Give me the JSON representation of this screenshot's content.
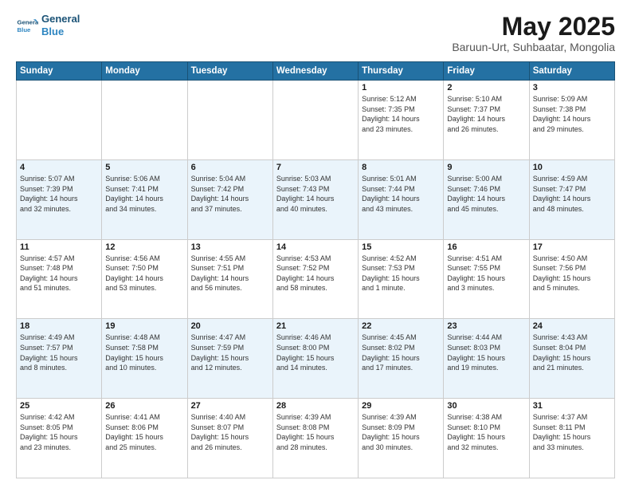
{
  "logo": {
    "line1": "General",
    "line2": "Blue"
  },
  "title": "May 2025",
  "subtitle": "Baruun-Urt, Suhbaatar, Mongolia",
  "days_of_week": [
    "Sunday",
    "Monday",
    "Tuesday",
    "Wednesday",
    "Thursday",
    "Friday",
    "Saturday"
  ],
  "weeks": [
    [
      {
        "num": "",
        "info": ""
      },
      {
        "num": "",
        "info": ""
      },
      {
        "num": "",
        "info": ""
      },
      {
        "num": "",
        "info": ""
      },
      {
        "num": "1",
        "info": "Sunrise: 5:12 AM\nSunset: 7:35 PM\nDaylight: 14 hours\nand 23 minutes."
      },
      {
        "num": "2",
        "info": "Sunrise: 5:10 AM\nSunset: 7:37 PM\nDaylight: 14 hours\nand 26 minutes."
      },
      {
        "num": "3",
        "info": "Sunrise: 5:09 AM\nSunset: 7:38 PM\nDaylight: 14 hours\nand 29 minutes."
      }
    ],
    [
      {
        "num": "4",
        "info": "Sunrise: 5:07 AM\nSunset: 7:39 PM\nDaylight: 14 hours\nand 32 minutes."
      },
      {
        "num": "5",
        "info": "Sunrise: 5:06 AM\nSunset: 7:41 PM\nDaylight: 14 hours\nand 34 minutes."
      },
      {
        "num": "6",
        "info": "Sunrise: 5:04 AM\nSunset: 7:42 PM\nDaylight: 14 hours\nand 37 minutes."
      },
      {
        "num": "7",
        "info": "Sunrise: 5:03 AM\nSunset: 7:43 PM\nDaylight: 14 hours\nand 40 minutes."
      },
      {
        "num": "8",
        "info": "Sunrise: 5:01 AM\nSunset: 7:44 PM\nDaylight: 14 hours\nand 43 minutes."
      },
      {
        "num": "9",
        "info": "Sunrise: 5:00 AM\nSunset: 7:46 PM\nDaylight: 14 hours\nand 45 minutes."
      },
      {
        "num": "10",
        "info": "Sunrise: 4:59 AM\nSunset: 7:47 PM\nDaylight: 14 hours\nand 48 minutes."
      }
    ],
    [
      {
        "num": "11",
        "info": "Sunrise: 4:57 AM\nSunset: 7:48 PM\nDaylight: 14 hours\nand 51 minutes."
      },
      {
        "num": "12",
        "info": "Sunrise: 4:56 AM\nSunset: 7:50 PM\nDaylight: 14 hours\nand 53 minutes."
      },
      {
        "num": "13",
        "info": "Sunrise: 4:55 AM\nSunset: 7:51 PM\nDaylight: 14 hours\nand 56 minutes."
      },
      {
        "num": "14",
        "info": "Sunrise: 4:53 AM\nSunset: 7:52 PM\nDaylight: 14 hours\nand 58 minutes."
      },
      {
        "num": "15",
        "info": "Sunrise: 4:52 AM\nSunset: 7:53 PM\nDaylight: 15 hours\nand 1 minute."
      },
      {
        "num": "16",
        "info": "Sunrise: 4:51 AM\nSunset: 7:55 PM\nDaylight: 15 hours\nand 3 minutes."
      },
      {
        "num": "17",
        "info": "Sunrise: 4:50 AM\nSunset: 7:56 PM\nDaylight: 15 hours\nand 5 minutes."
      }
    ],
    [
      {
        "num": "18",
        "info": "Sunrise: 4:49 AM\nSunset: 7:57 PM\nDaylight: 15 hours\nand 8 minutes."
      },
      {
        "num": "19",
        "info": "Sunrise: 4:48 AM\nSunset: 7:58 PM\nDaylight: 15 hours\nand 10 minutes."
      },
      {
        "num": "20",
        "info": "Sunrise: 4:47 AM\nSunset: 7:59 PM\nDaylight: 15 hours\nand 12 minutes."
      },
      {
        "num": "21",
        "info": "Sunrise: 4:46 AM\nSunset: 8:00 PM\nDaylight: 15 hours\nand 14 minutes."
      },
      {
        "num": "22",
        "info": "Sunrise: 4:45 AM\nSunset: 8:02 PM\nDaylight: 15 hours\nand 17 minutes."
      },
      {
        "num": "23",
        "info": "Sunrise: 4:44 AM\nSunset: 8:03 PM\nDaylight: 15 hours\nand 19 minutes."
      },
      {
        "num": "24",
        "info": "Sunrise: 4:43 AM\nSunset: 8:04 PM\nDaylight: 15 hours\nand 21 minutes."
      }
    ],
    [
      {
        "num": "25",
        "info": "Sunrise: 4:42 AM\nSunset: 8:05 PM\nDaylight: 15 hours\nand 23 minutes."
      },
      {
        "num": "26",
        "info": "Sunrise: 4:41 AM\nSunset: 8:06 PM\nDaylight: 15 hours\nand 25 minutes."
      },
      {
        "num": "27",
        "info": "Sunrise: 4:40 AM\nSunset: 8:07 PM\nDaylight: 15 hours\nand 26 minutes."
      },
      {
        "num": "28",
        "info": "Sunrise: 4:39 AM\nSunset: 8:08 PM\nDaylight: 15 hours\nand 28 minutes."
      },
      {
        "num": "29",
        "info": "Sunrise: 4:39 AM\nSunset: 8:09 PM\nDaylight: 15 hours\nand 30 minutes."
      },
      {
        "num": "30",
        "info": "Sunrise: 4:38 AM\nSunset: 8:10 PM\nDaylight: 15 hours\nand 32 minutes."
      },
      {
        "num": "31",
        "info": "Sunrise: 4:37 AM\nSunset: 8:11 PM\nDaylight: 15 hours\nand 33 minutes."
      }
    ]
  ]
}
